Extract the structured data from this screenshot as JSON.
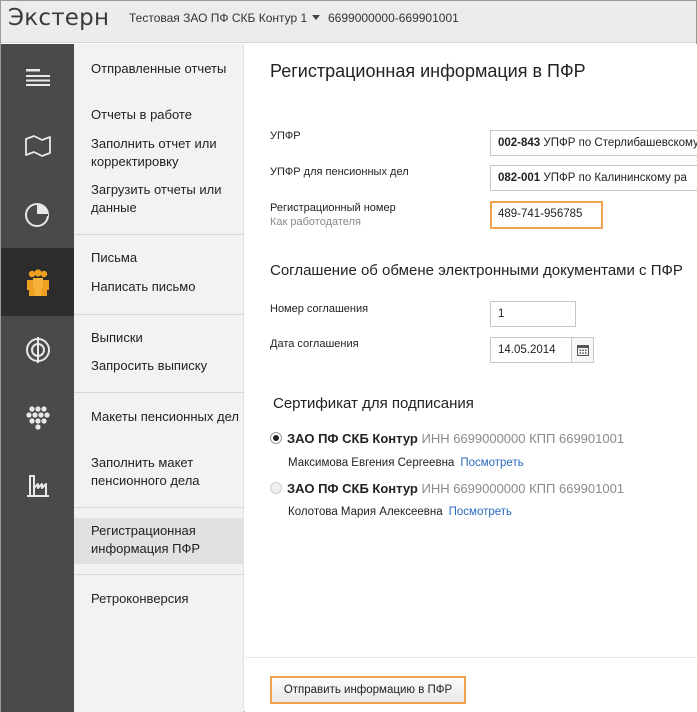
{
  "app": {
    "name": "Экстерн",
    "org_name": "Тестовая ЗАО ПФ СКБ Контур 1",
    "inn_kpp": "6699000000-669901001"
  },
  "rail": {
    "items": [
      {
        "icon": "reports-list-icon"
      },
      {
        "icon": "map-icon"
      },
      {
        "icon": "pie-chart-icon"
      },
      {
        "icon": "people-icon",
        "active": true
      },
      {
        "icon": "target-icon"
      },
      {
        "icon": "grapes-icon"
      },
      {
        "icon": "factory-icon"
      }
    ],
    "active_color": "#f0a020"
  },
  "menu": {
    "items": [
      {
        "label": "Отправленные отчеты"
      },
      {
        "label": "Отчеты в работе"
      },
      {
        "label": "Заполнить отчет или корректировку"
      },
      {
        "label": "Загрузить отчеты или данные"
      },
      {
        "label": "Письма"
      },
      {
        "label": "Написать письмо"
      },
      {
        "label": "Выписки"
      },
      {
        "label": "Запросить выписку"
      },
      {
        "label": "Макеты пенсионных дел"
      },
      {
        "label": "Заполнить макет пенсионного дела"
      },
      {
        "label": "Регистрационная информация ПФР",
        "active": true
      },
      {
        "label": "Ретроконверсия"
      }
    ]
  },
  "main": {
    "title": "Регистрационная информация в ПФР",
    "upfr": {
      "label": "УПФР",
      "code": "002-843",
      "name": "УПФР по Стерлибашевскому"
    },
    "upfr_pension": {
      "label": "УПФР для пенсионных дел",
      "code": "082-001",
      "name": "УПФР по Калининскому ра"
    },
    "reg_number": {
      "label": "Регистрационный номер",
      "sublabel": "Как работодателя",
      "value": "489-741-956785"
    },
    "agreement": {
      "title": "Соглашение об обмене электронными документами с ПФР",
      "number_label": "Номер соглашения",
      "number_value": "1",
      "date_label": "Дата соглашения",
      "date_value": "14.05.2014"
    },
    "certificates": {
      "title": "Сертификат для подписания",
      "items": [
        {
          "org": "ЗАО ПФ СКБ Контур",
          "details": "ИНН 6699000000 КПП 669901001",
          "person": "Максимова Евгения Сергеевна",
          "link": "Посмотреть",
          "selected": true
        },
        {
          "org": "ЗАО ПФ СКБ Контур",
          "details": "ИНН 6699000000 КПП 669901001",
          "person": "Колотова Мария Алексеевна",
          "link": "Посмотреть",
          "selected": false
        }
      ]
    },
    "submit_label": "Отправить информацию в ПФР"
  },
  "colors": {
    "accent_orange": "#f0a34f",
    "link_blue": "#2a6bbf"
  }
}
